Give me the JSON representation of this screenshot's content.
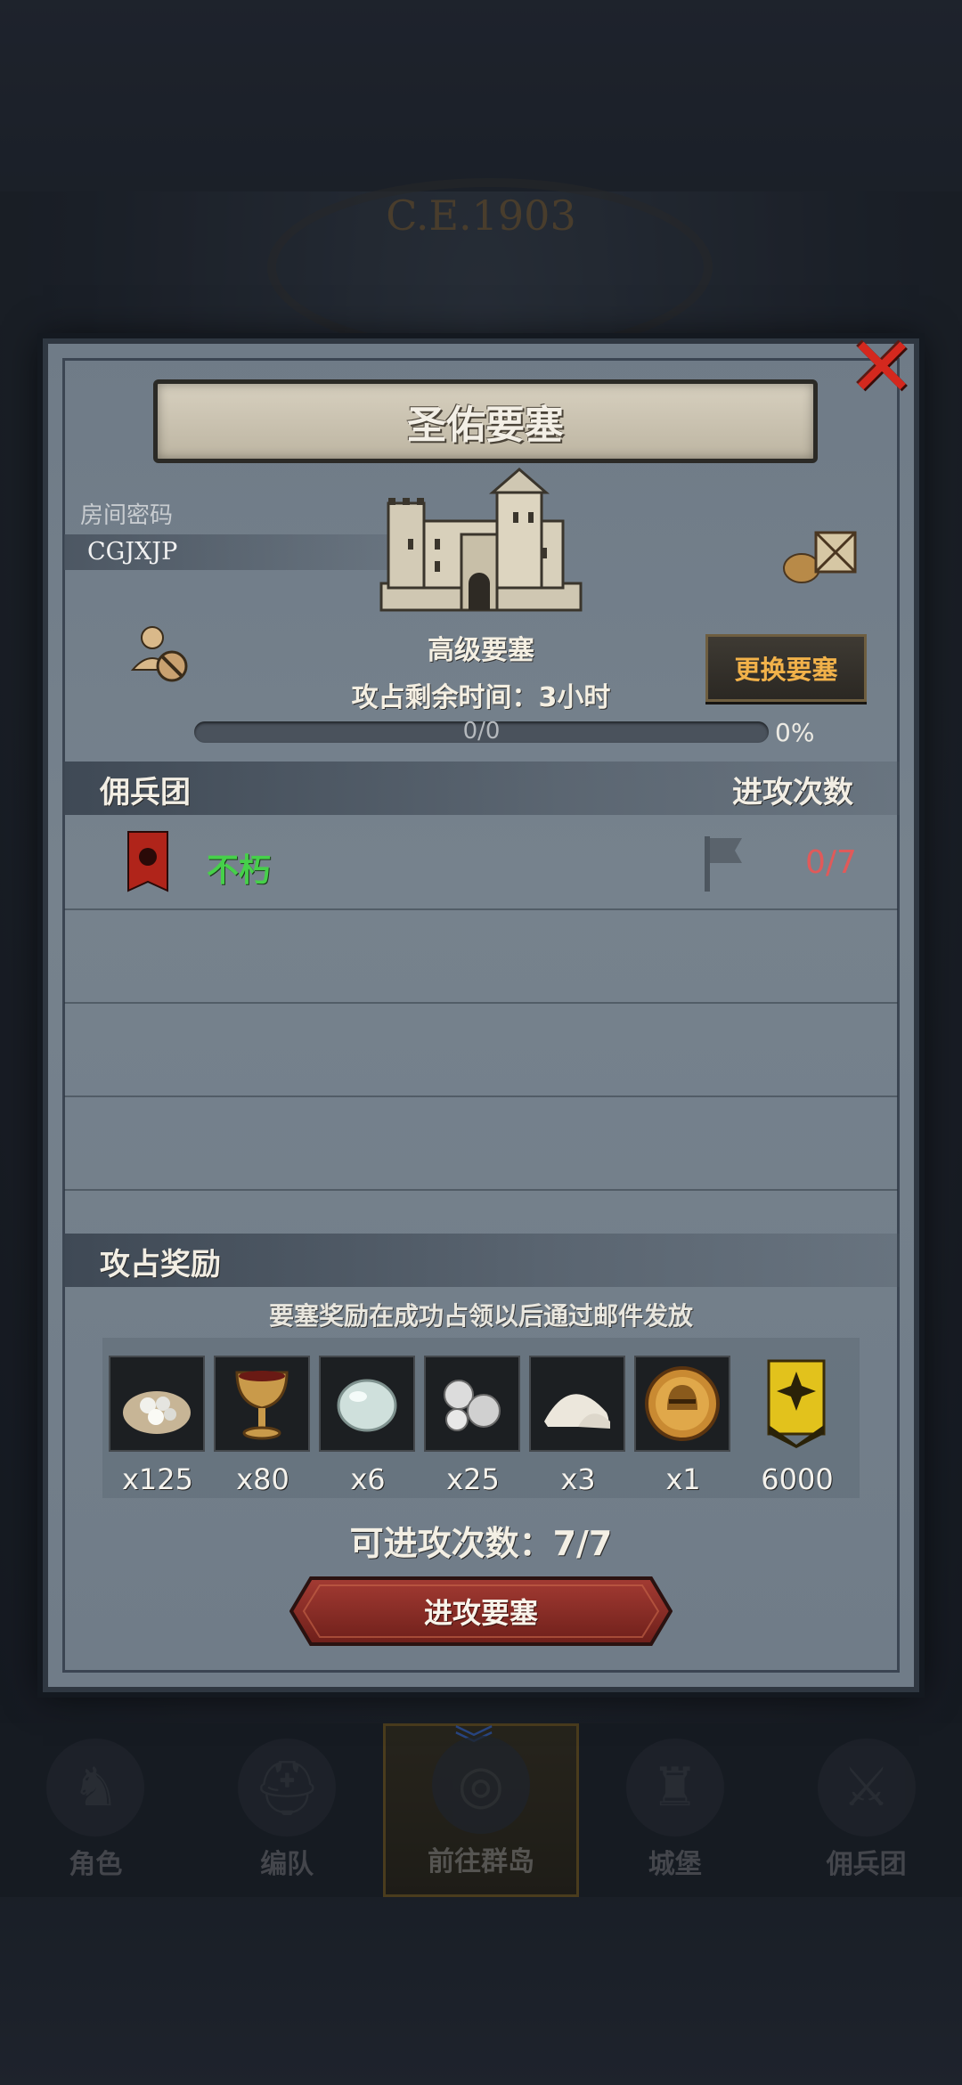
{
  "background": {
    "era_label": "C.E.1903"
  },
  "bottom_nav": {
    "items": [
      {
        "label": "角色",
        "icon": "knight-icon",
        "active": false
      },
      {
        "label": "编队",
        "icon": "helmet-icon",
        "active": false
      },
      {
        "label": "前往群岛",
        "icon": "globe-icon",
        "active": true
      },
      {
        "label": "城堡",
        "icon": "castle-icon",
        "active": false
      },
      {
        "label": "佣兵团",
        "icon": "mercenary-icon",
        "active": false
      }
    ]
  },
  "dialog": {
    "title": "圣佑要塞",
    "close_icon": "close-x-icon",
    "room_password_label": "房间密码",
    "room_code": "CGJXJP",
    "fortress_level": "高级要塞",
    "change_fortress_label": "更换要塞",
    "time_left_text": "攻占剩余时间：3小时",
    "progress": {
      "text": "0/0",
      "percent_text": "0%",
      "fraction": 0.0
    },
    "guild_section": {
      "left_title": "佣兵团",
      "right_title": "进攻次数"
    },
    "guilds": [
      {
        "name": "不朽",
        "attacks": "0/7",
        "banner_color": "#b0241a"
      }
    ],
    "reward_section_title": "攻占奖励",
    "reward_note": "要塞奖励在成功占领以后通过邮件发放",
    "rewards": [
      {
        "icon": "silver-ore-sack-icon",
        "qty": "x125"
      },
      {
        "icon": "goblet-icon",
        "qty": "x80"
      },
      {
        "icon": "pearl-stone-icon",
        "qty": "x6"
      },
      {
        "icon": "silver-pearls-icon",
        "qty": "x25"
      },
      {
        "icon": "salt-pile-icon",
        "qty": "x3"
      },
      {
        "icon": "golden-helmet-coin-icon",
        "qty": "x1"
      },
      {
        "icon": "rank-badge-icon",
        "qty": "6000"
      }
    ],
    "attempts_text": "可进攻次数：7/7",
    "attack_button_label": "进攻要塞"
  }
}
